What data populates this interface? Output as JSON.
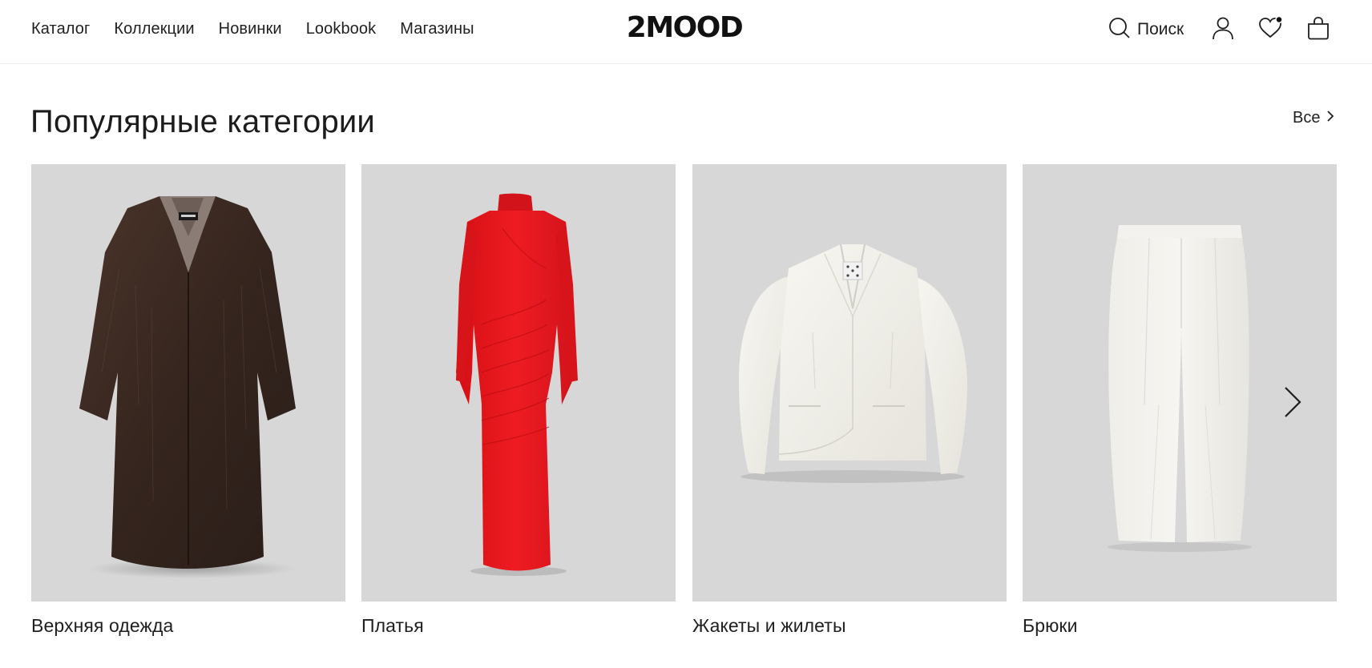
{
  "header": {
    "nav": [
      "Каталог",
      "Коллекции",
      "Новинки",
      "Lookbook",
      "Магазины"
    ],
    "logo": "2MOOD",
    "search_label": "Поиск",
    "icons": [
      "search-icon",
      "user-icon",
      "heart-icon",
      "bag-icon"
    ]
  },
  "section": {
    "title": "Популярные категории",
    "all_label": "Все"
  },
  "categories": [
    {
      "label": "Верхняя одежда",
      "image": "brown-fur-coat"
    },
    {
      "label": "Платья",
      "image": "red-dress"
    },
    {
      "label": "Жакеты и жилеты",
      "image": "white-jacket"
    },
    {
      "label": "Брюки",
      "image": "white-trousers"
    }
  ],
  "colors": {
    "card_background": "#d7d7d7",
    "text": "#1f1f1f",
    "wishlist_dot": "#111111"
  }
}
